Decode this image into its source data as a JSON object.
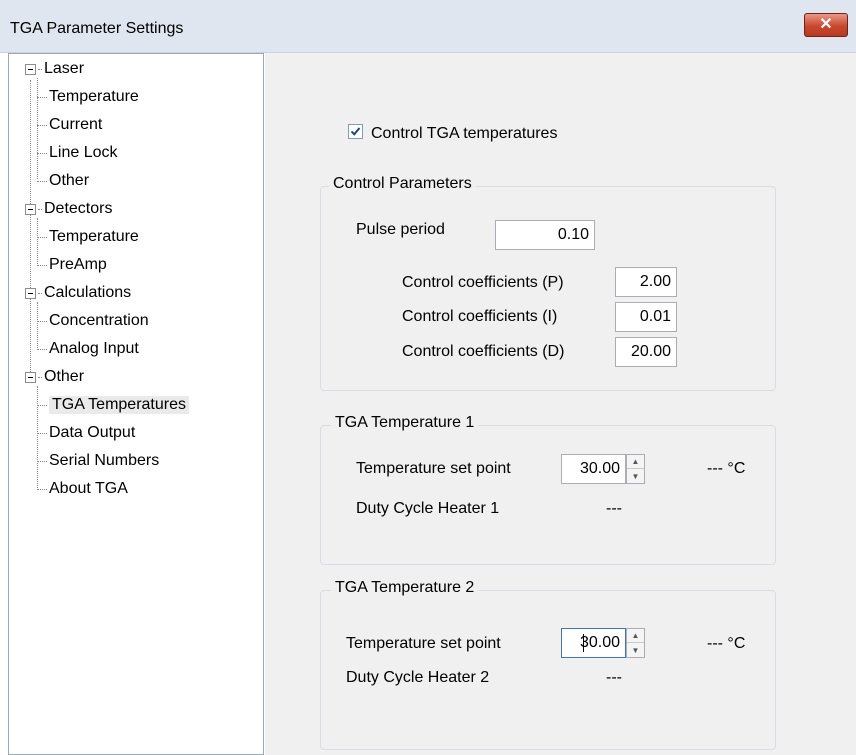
{
  "window": {
    "title": "TGA Parameter Settings",
    "close_label": "✕"
  },
  "tree": {
    "groups": [
      {
        "label": "Laser",
        "children": [
          "Temperature",
          "Current",
          "Line Lock",
          "Other"
        ]
      },
      {
        "label": "Detectors",
        "children": [
          "Temperature",
          "PreAmp"
        ]
      },
      {
        "label": "Calculations",
        "children": [
          "Concentration",
          "Analog Input"
        ]
      },
      {
        "label": "Other",
        "children": [
          "TGA Temperatures",
          "Data Output",
          "Serial Numbers",
          "About TGA"
        ]
      }
    ],
    "selected": "TGA Temperatures"
  },
  "control": {
    "checkbox_label": "Control TGA temperatures",
    "checked": true
  },
  "control_parameters": {
    "legend": "Control Parameters",
    "pulse_period_label": "Pulse period",
    "pulse_period_value": "0.10",
    "p_label": "Control coefficients (P)",
    "p_value": "2.00",
    "i_label": "Control coefficients  (I)",
    "i_value": "0.01",
    "d_label": "Control coefficients (D)",
    "d_value": "20.00"
  },
  "temp1": {
    "legend": "TGA Temperature 1",
    "setpoint_label": "Temperature set point",
    "setpoint_value": "30.00",
    "reading": "---  °C",
    "duty_label": "Duty Cycle Heater 1",
    "duty_value": "---"
  },
  "temp2": {
    "legend": "TGA Temperature 2",
    "setpoint_label": "Temperature set point",
    "setpoint_value": "30.00",
    "reading": "---  °C",
    "duty_label": "Duty Cycle Heater 2",
    "duty_value": "---"
  },
  "colors": {
    "selection": "#eaeaea",
    "close_button": "#c9482f",
    "panel": "#f0f0f0"
  }
}
